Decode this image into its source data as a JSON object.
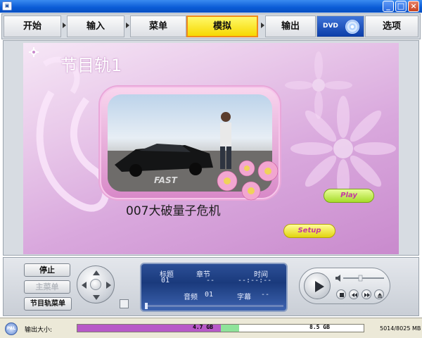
{
  "window": {
    "minimize": "_",
    "maximize": "□",
    "close": "×"
  },
  "nav": {
    "tabs": [
      {
        "label": "开始"
      },
      {
        "label": "输入"
      },
      {
        "label": "菜单"
      },
      {
        "label": "模拟",
        "active": true
      },
      {
        "label": "输出"
      },
      {
        "label": "选项"
      }
    ],
    "dvd_label": "DVD"
  },
  "preview": {
    "title": "节目轨1",
    "movie_title": "007大破量子危机",
    "play_button": "Play",
    "setup_button": "Setup",
    "photo_logo_text": "FAST"
  },
  "controls": {
    "stop_button": "停止",
    "main_menu_button": "主菜单",
    "title_menu_button": "节目轨菜单",
    "info": {
      "title_label": "标题",
      "chapter_label": "章节",
      "time_label": "时间",
      "title_value": "01",
      "chapter_value": "--",
      "time_value": "--:--:--",
      "audio_label": "音频",
      "audio_value": "01",
      "subtitle_label": "字幕",
      "subtitle_value": "--"
    }
  },
  "status": {
    "badge": "PAL",
    "size_label": "输出大小:",
    "used_mark": "4.7 GB",
    "capacity_mark": "8.5 GB",
    "counter": "5014/8025 MB",
    "used_fraction": 0.5,
    "green_fraction": 0.065
  },
  "colors": {
    "active_tab": "#f6d800",
    "active_tab_border": "#f08a1c",
    "titlebar": "#0a5bd6",
    "used_bar": "#b759c8",
    "free_bar": "#8ee39a"
  }
}
